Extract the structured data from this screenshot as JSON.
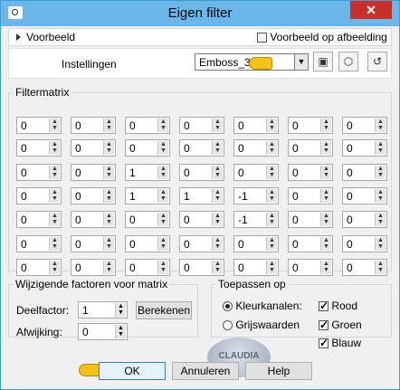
{
  "window": {
    "title": "Eigen filter",
    "close_glyph": "✕",
    "colors": {
      "titlebar": "#6cb7ea",
      "close": "#c7302b",
      "body": "#f0f0f0"
    }
  },
  "preview": {
    "label": "Voorbeeld",
    "on_image_label": "Voorbeeld op afbeelding",
    "on_image_checked": false
  },
  "settings": {
    "label": "Instellingen",
    "preset_value": "Emboss_3",
    "icons": [
      "save-preset-icon",
      "randomize-icon",
      "reset-icon"
    ]
  },
  "matrix": {
    "legend": "Filtermatrix",
    "rows": [
      [
        "0",
        "0",
        "0",
        "0",
        "0",
        "0",
        "0"
      ],
      [
        "0",
        "0",
        "0",
        "0",
        "0",
        "0",
        "0"
      ],
      [
        "0",
        "0",
        "1",
        "0",
        "0",
        "0",
        "0"
      ],
      [
        "0",
        "0",
        "1",
        "1",
        "-1",
        "0",
        "0"
      ],
      [
        "0",
        "0",
        "0",
        "0",
        "-1",
        "0",
        "0"
      ],
      [
        "0",
        "0",
        "0",
        "0",
        "0",
        "0",
        "0"
      ],
      [
        "0",
        "0",
        "0",
        "0",
        "0",
        "0",
        "0"
      ]
    ]
  },
  "factors": {
    "legend": "Wijzigende factoren voor matrix",
    "divisor_label": "Deelfactor:",
    "divisor_value": "1",
    "calculate_label": "Berekenen",
    "bias_label": "Afwijking:",
    "bias_value": "0"
  },
  "apply": {
    "legend": "Toepassen op",
    "color_channels_label": "Kleurkanalen:",
    "grayscale_label": "Grijswaarden",
    "mode": "color",
    "red_label": "Rood",
    "green_label": "Groen",
    "blue_label": "Blauw",
    "red_checked": true,
    "green_checked": true,
    "blue_checked": true
  },
  "buttons": {
    "ok": "OK",
    "cancel": "Annuleren",
    "help": "Help"
  },
  "watermark": {
    "text": "CLAUDIA"
  }
}
